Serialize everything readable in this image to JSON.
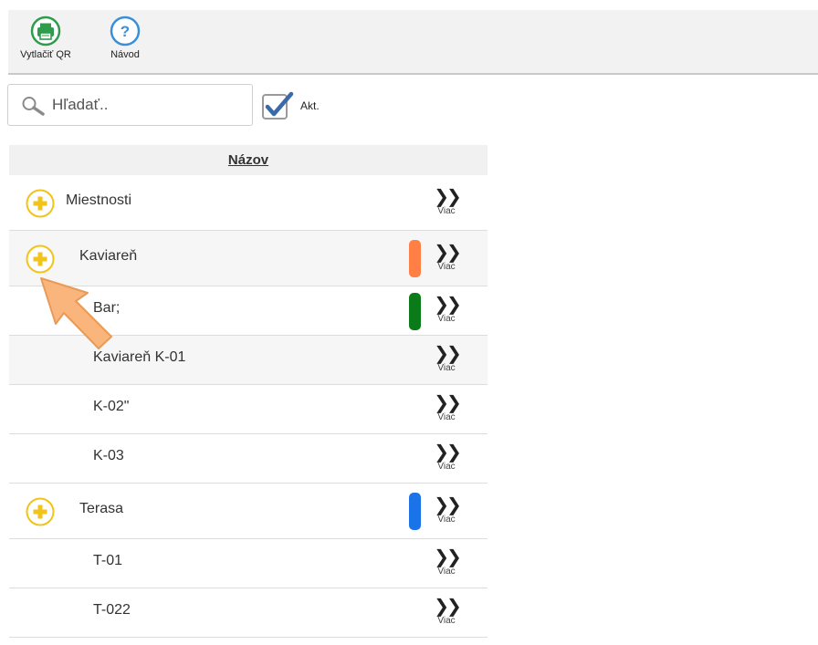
{
  "toolbar": {
    "print_label": "Vytlačiť QR",
    "print_icon": "printer-icon",
    "print_color": "#2e9c4c",
    "help_label": "Návod",
    "help_icon": "question-icon",
    "help_color": "#3b8fd9"
  },
  "search": {
    "placeholder": "Hľadať..",
    "value": ""
  },
  "filter": {
    "akt_label": "Akt.",
    "akt_checked": true
  },
  "table": {
    "column_header": "Názov",
    "more_label": "Viac",
    "rows": [
      {
        "name": "Miestnosti",
        "level": 0,
        "expandable": true,
        "color": null
      },
      {
        "name": "Kaviareň",
        "level": 1,
        "expandable": true,
        "color": "#ff7f45"
      },
      {
        "name": "Bar;",
        "level": 2,
        "expandable": false,
        "color": "#0b7a19"
      },
      {
        "name": "Kaviareň K-01",
        "level": 2,
        "expandable": false,
        "color": null
      },
      {
        "name": "K-02\"",
        "level": 2,
        "expandable": false,
        "color": null
      },
      {
        "name": "K-03",
        "level": 2,
        "expandable": false,
        "color": null
      },
      {
        "name": "Terasa",
        "level": 1,
        "expandable": true,
        "color": "#1a73e8"
      },
      {
        "name": "T-01",
        "level": 2,
        "expandable": false,
        "color": null
      },
      {
        "name": "T-022",
        "level": 2,
        "expandable": false,
        "color": null
      }
    ]
  },
  "colors": {
    "add_icon": "#f2c318",
    "pointer_arrow": "#f9b57c"
  }
}
